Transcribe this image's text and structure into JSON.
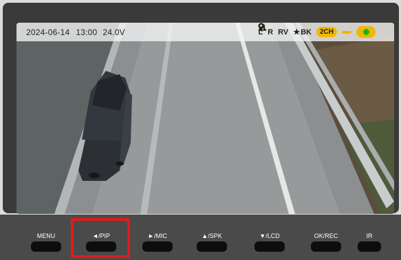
{
  "status_bar": {
    "date": "2024-06-14",
    "time": "13:00",
    "voltage": "24.0V",
    "indicators": [
      {
        "icon": "bulb-icon",
        "label": "L"
      },
      {
        "icon": "bulb-icon",
        "label": "R"
      },
      {
        "icon": "bulb-icon",
        "label": "RV"
      },
      {
        "icon": "star-icon",
        "label": "BK"
      }
    ],
    "channels_label": "2CH",
    "warning_icon": "warning-icon",
    "recording_icon": "recording-camera-icon",
    "audio_icon": "speaker-icon",
    "mic_icon": "mic-icon",
    "location_icon": "location-pin-icon",
    "accent_color": "#f2b705",
    "recording_color": "#18b418"
  },
  "buttons": [
    {
      "label": "MENU"
    },
    {
      "label": "◄/PIP"
    },
    {
      "label": "►/MIC"
    },
    {
      "label": "▲/SPK"
    },
    {
      "label": "▼/LCD"
    },
    {
      "label": "OK/REC"
    },
    {
      "label": "IR"
    }
  ],
  "highlight_color": "#e01b1b"
}
